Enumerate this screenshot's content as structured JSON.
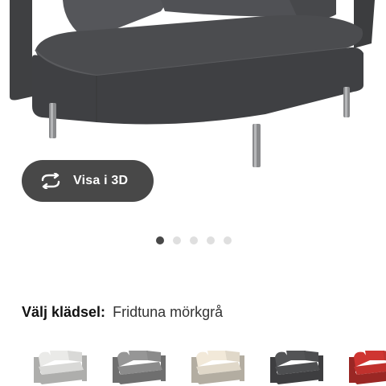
{
  "viewer": {
    "button_label": "Visa i 3D",
    "button_icon": "rotate-3d-icon"
  },
  "carousel": {
    "count": 5,
    "active_index": 0
  },
  "upholstery": {
    "label": "Välj klädsel:",
    "value": "Fridtuna mörkgrå"
  },
  "swatches": [
    {
      "name": "light-grey",
      "color": "#d9d9d7"
    },
    {
      "name": "grey",
      "color": "#8b8b8b"
    },
    {
      "name": "beige",
      "color": "#e0d8c9"
    },
    {
      "name": "dark-grey",
      "color": "#4d4e50",
      "selected": true
    },
    {
      "name": "red",
      "color": "#c0312d"
    }
  ],
  "colors": {
    "sofa": "#4b4c4e",
    "button_bg": "#484848",
    "dot_active": "#484848",
    "dot_inactive": "#dfdfdf"
  }
}
